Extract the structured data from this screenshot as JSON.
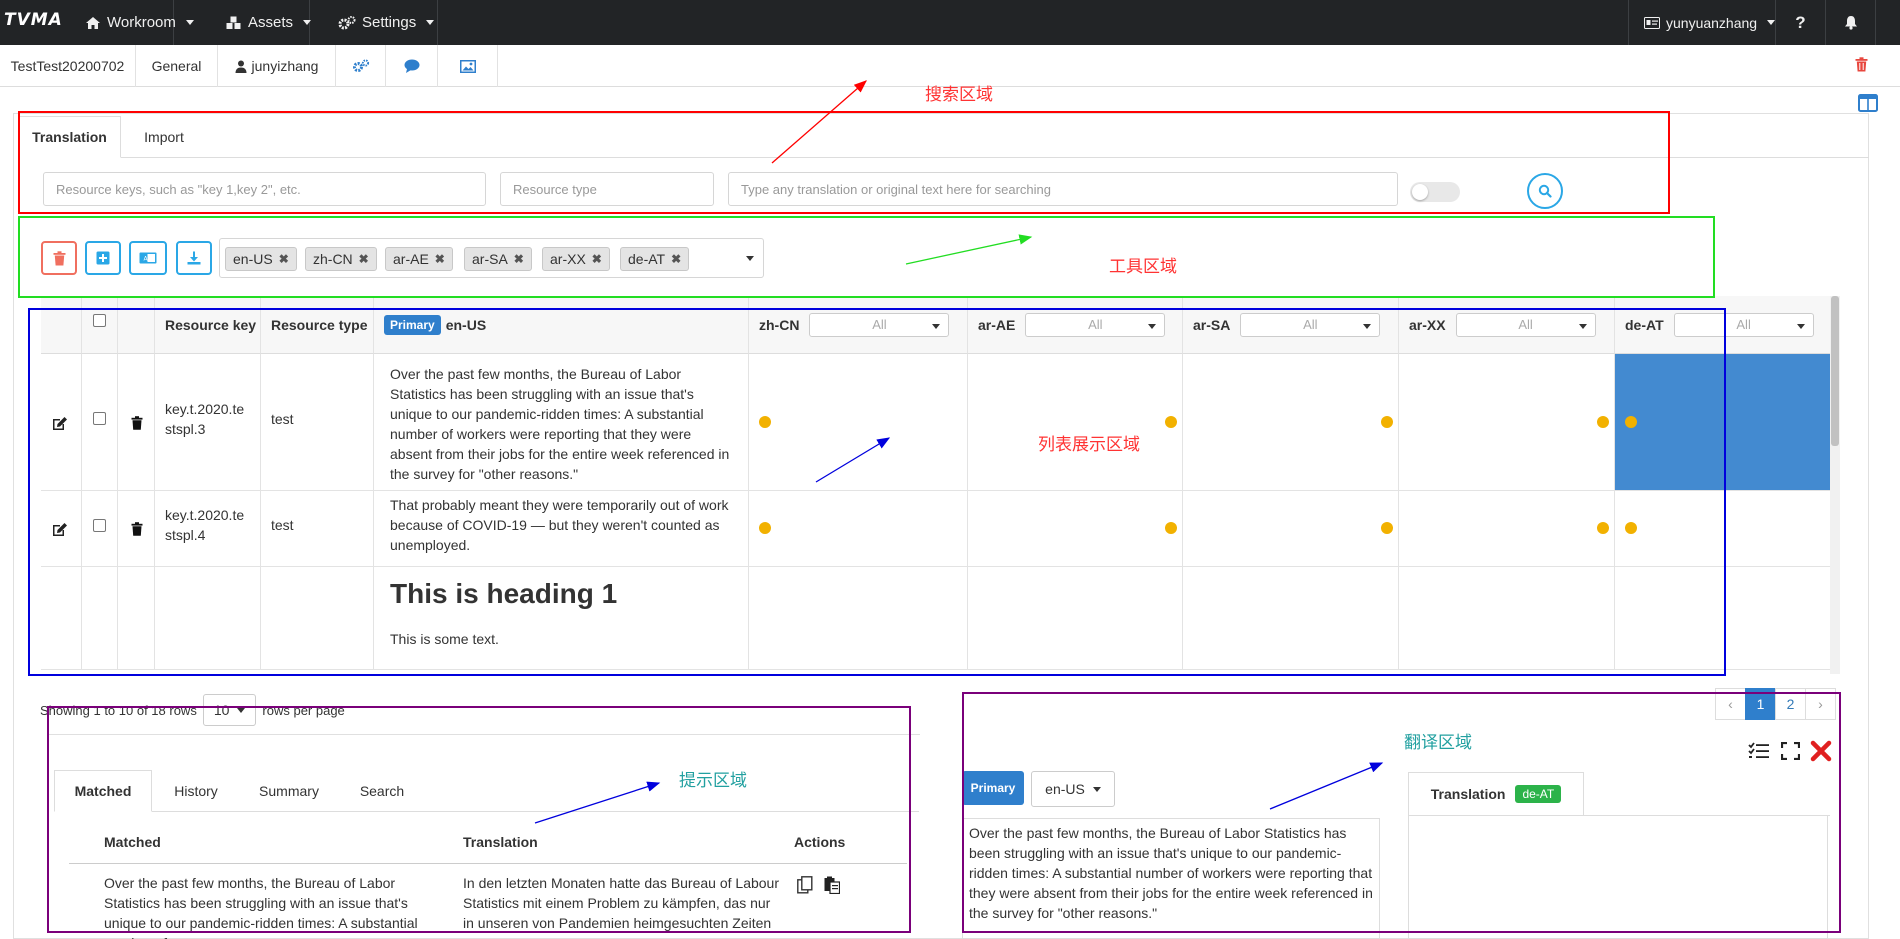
{
  "topnav": {
    "brand": "TVMA",
    "workroom": "Workroom",
    "assets": "Assets",
    "settings": "Settings",
    "user": "yunyuanzhang",
    "help": "?"
  },
  "subnav": {
    "project": "TestTest20200702",
    "general": "General",
    "owner": "junyizhang"
  },
  "tabs": {
    "translation": "Translation",
    "import": "Import"
  },
  "search": {
    "keys_placeholder": "Resource keys, such as \"key 1,key 2\", etc.",
    "type_placeholder": "Resource type",
    "text_placeholder": "Type any translation or original text here for searching"
  },
  "languages": [
    "en-US",
    "zh-CN",
    "ar-AE",
    "ar-SA",
    "ar-XX",
    "de-AT"
  ],
  "table": {
    "headers": {
      "key": "Resource key",
      "type": "Resource type",
      "primary": "Primary",
      "source_lang": "en-US",
      "filter_all": "All"
    },
    "filter_langs": [
      "zh-CN",
      "ar-AE",
      "ar-SA",
      "ar-XX",
      "de-AT"
    ],
    "rows": [
      {
        "key": "key.t.2020.testspl.3",
        "type": "test",
        "text": "Over the past few months, the Bureau of Labor Statistics has been struggling with an issue that's unique to our pandemic-ridden times: A substantial number of workers were reporting that they were absent from their jobs for the entire week referenced in the survey for \"other reasons.\""
      },
      {
        "key": "key.t.2020.testspl.4",
        "type": "test",
        "text": "That probably meant they were temporarily out of work because of COVID-19 — but they weren't counted as unemployed."
      },
      {
        "heading": "This is heading 1",
        "text": "This is some text."
      }
    ]
  },
  "pagination": {
    "showing_prefix": "Showing 1 to 10 of 18 rows",
    "per_page": "10",
    "per_page_suffix": "rows per page",
    "prev": "‹",
    "pages": [
      "1",
      "2"
    ],
    "next": "›"
  },
  "bottom_tabs": [
    "Matched",
    "History",
    "Summary",
    "Search"
  ],
  "matched": {
    "headers": [
      "Matched",
      "Translation",
      "Actions"
    ],
    "matched_text": "Over the past few months, the Bureau of Labor Statistics has been struggling with an issue that's unique to our pandemic-ridden times: A substantial number of",
    "translation_text": "In den letzten Monaten hatte das Bureau of Labour Statistics mit einem Problem zu kämpfen, das nur in unseren von Pandemien heimgesuchten Zeiten"
  },
  "translate_panel": {
    "primary": "Primary",
    "source_lang": "en-US",
    "source_text": "Over the past few months, the Bureau of Labor Statistics has been struggling with an issue that's unique to our pandemic-ridden times: A substantial number of workers were reporting that they were absent from their jobs for the entire week referenced in the survey for \"other reasons.\"",
    "tab_label": "Translation",
    "target_lang": "de-AT"
  },
  "annotations": {
    "search": "搜索区域",
    "tools": "工具区域",
    "list": "列表展示区域",
    "hint": "提示区域",
    "translate": "翻译区域"
  },
  "colors": {
    "nav_bg": "#222426",
    "accent": "#2f7fcc",
    "dot": "#f2b100",
    "selected_cell": "#438ad0",
    "anno_search": "#ff0000",
    "anno_tools": "#22dd22",
    "anno_list": "#0000dd",
    "anno_hint": "#7a007a",
    "anno_translate": "#7a007a"
  }
}
